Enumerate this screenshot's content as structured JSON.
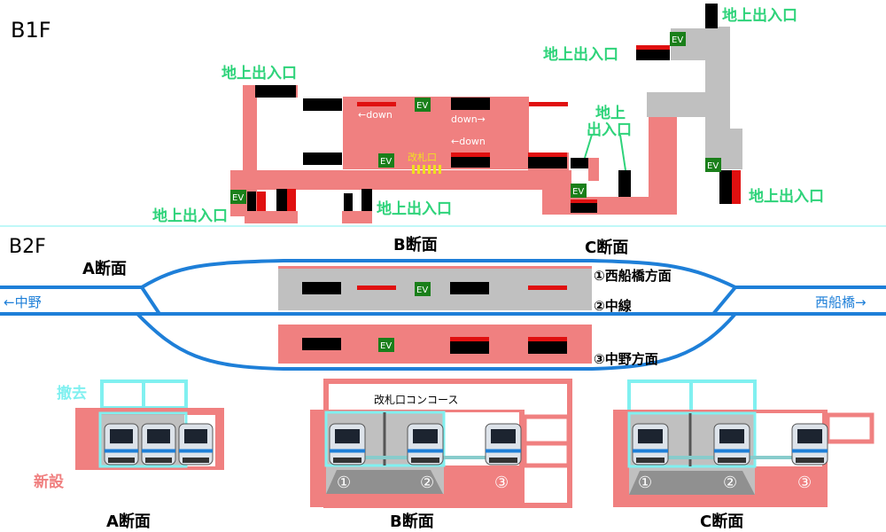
{
  "colors": {
    "new_construction": "#f08080",
    "removed": "#80f0f0",
    "exit_label": "#2ed37a",
    "ev_green": "#1a7f1a",
    "track_blue": "#1e7fd8",
    "platform_gray": "#c0c0c0",
    "stair_black": "#000000",
    "red_accent": "#e01010",
    "gate_yellow": "#f0e020"
  },
  "b1f": {
    "title": "B1F",
    "exits": [
      "地上出入口",
      "地上出入口",
      "地上出入口",
      "地上出入口",
      "地上出入口",
      "地上\n出入口"
    ],
    "ev": "EV",
    "down_left": "←down",
    "down_right": "down→",
    "down_left2": "←down",
    "gate": "改札口"
  },
  "b2f": {
    "title": "B2F",
    "section_a": "A断面",
    "section_b": "B断面",
    "section_c": "C断面",
    "dir_left": "←中野",
    "dir_right": "西船橋→",
    "track1": "①西船橋方面",
    "track2": "②中線",
    "track3": "③中野方面",
    "ev": "EV"
  },
  "sections": {
    "legend_removed": "撤去",
    "legend_new": "新設",
    "concourse": "改札口コンコース",
    "label_a": "A断面",
    "label_b": "B断面",
    "label_c": "C断面",
    "track_numbers": [
      "①",
      "②",
      "③"
    ]
  }
}
